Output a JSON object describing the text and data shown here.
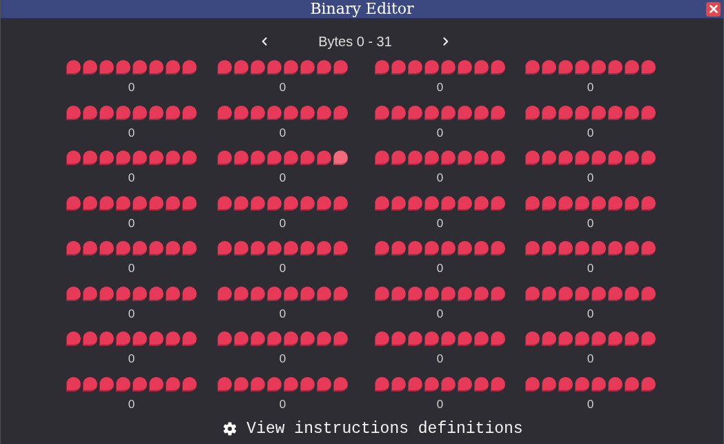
{
  "window": {
    "title": "Binary Editor"
  },
  "pager": {
    "label": "Bytes 0 - 31"
  },
  "bytes": [
    {
      "bits": [
        {
          "on": false,
          "hovered": false
        },
        {
          "on": false,
          "hovered": false
        },
        {
          "on": false,
          "hovered": false
        },
        {
          "on": false,
          "hovered": false
        },
        {
          "on": false,
          "hovered": false
        },
        {
          "on": false,
          "hovered": false
        },
        {
          "on": false,
          "hovered": false
        },
        {
          "on": false,
          "hovered": false
        }
      ],
      "value": "0"
    },
    {
      "bits": [
        {
          "on": false,
          "hovered": false
        },
        {
          "on": false,
          "hovered": false
        },
        {
          "on": false,
          "hovered": false
        },
        {
          "on": false,
          "hovered": false
        },
        {
          "on": false,
          "hovered": false
        },
        {
          "on": false,
          "hovered": false
        },
        {
          "on": false,
          "hovered": false
        },
        {
          "on": false,
          "hovered": false
        }
      ],
      "value": "0"
    },
    {
      "bits": [
        {
          "on": false,
          "hovered": false
        },
        {
          "on": false,
          "hovered": false
        },
        {
          "on": false,
          "hovered": false
        },
        {
          "on": false,
          "hovered": false
        },
        {
          "on": false,
          "hovered": false
        },
        {
          "on": false,
          "hovered": false
        },
        {
          "on": false,
          "hovered": false
        },
        {
          "on": false,
          "hovered": false
        }
      ],
      "value": "0"
    },
    {
      "bits": [
        {
          "on": false,
          "hovered": false
        },
        {
          "on": false,
          "hovered": false
        },
        {
          "on": false,
          "hovered": false
        },
        {
          "on": false,
          "hovered": false
        },
        {
          "on": false,
          "hovered": false
        },
        {
          "on": false,
          "hovered": false
        },
        {
          "on": false,
          "hovered": false
        },
        {
          "on": false,
          "hovered": false
        }
      ],
      "value": "0"
    },
    {
      "bits": [
        {
          "on": false,
          "hovered": false
        },
        {
          "on": false,
          "hovered": false
        },
        {
          "on": false,
          "hovered": false
        },
        {
          "on": false,
          "hovered": false
        },
        {
          "on": false,
          "hovered": false
        },
        {
          "on": false,
          "hovered": false
        },
        {
          "on": false,
          "hovered": false
        },
        {
          "on": false,
          "hovered": false
        }
      ],
      "value": "0"
    },
    {
      "bits": [
        {
          "on": false,
          "hovered": false
        },
        {
          "on": false,
          "hovered": false
        },
        {
          "on": false,
          "hovered": false
        },
        {
          "on": false,
          "hovered": false
        },
        {
          "on": false,
          "hovered": false
        },
        {
          "on": false,
          "hovered": false
        },
        {
          "on": false,
          "hovered": false
        },
        {
          "on": false,
          "hovered": false
        }
      ],
      "value": "0"
    },
    {
      "bits": [
        {
          "on": false,
          "hovered": false
        },
        {
          "on": false,
          "hovered": false
        },
        {
          "on": false,
          "hovered": false
        },
        {
          "on": false,
          "hovered": false
        },
        {
          "on": false,
          "hovered": false
        },
        {
          "on": false,
          "hovered": false
        },
        {
          "on": false,
          "hovered": false
        },
        {
          "on": false,
          "hovered": false
        }
      ],
      "value": "0"
    },
    {
      "bits": [
        {
          "on": false,
          "hovered": false
        },
        {
          "on": false,
          "hovered": false
        },
        {
          "on": false,
          "hovered": false
        },
        {
          "on": false,
          "hovered": false
        },
        {
          "on": false,
          "hovered": false
        },
        {
          "on": false,
          "hovered": false
        },
        {
          "on": false,
          "hovered": false
        },
        {
          "on": false,
          "hovered": false
        }
      ],
      "value": "0"
    },
    {
      "bits": [
        {
          "on": false,
          "hovered": false
        },
        {
          "on": false,
          "hovered": false
        },
        {
          "on": false,
          "hovered": false
        },
        {
          "on": false,
          "hovered": false
        },
        {
          "on": false,
          "hovered": false
        },
        {
          "on": false,
          "hovered": false
        },
        {
          "on": false,
          "hovered": false
        },
        {
          "on": false,
          "hovered": false
        }
      ],
      "value": "0"
    },
    {
      "bits": [
        {
          "on": false,
          "hovered": false
        },
        {
          "on": false,
          "hovered": false
        },
        {
          "on": false,
          "hovered": false
        },
        {
          "on": false,
          "hovered": false
        },
        {
          "on": false,
          "hovered": false
        },
        {
          "on": false,
          "hovered": false
        },
        {
          "on": false,
          "hovered": false
        },
        {
          "on": false,
          "hovered": true
        }
      ],
      "value": "0"
    },
    {
      "bits": [
        {
          "on": false,
          "hovered": false
        },
        {
          "on": false,
          "hovered": false
        },
        {
          "on": false,
          "hovered": false
        },
        {
          "on": false,
          "hovered": false
        },
        {
          "on": false,
          "hovered": false
        },
        {
          "on": false,
          "hovered": false
        },
        {
          "on": false,
          "hovered": false
        },
        {
          "on": false,
          "hovered": false
        }
      ],
      "value": "0"
    },
    {
      "bits": [
        {
          "on": false,
          "hovered": false
        },
        {
          "on": false,
          "hovered": false
        },
        {
          "on": false,
          "hovered": false
        },
        {
          "on": false,
          "hovered": false
        },
        {
          "on": false,
          "hovered": false
        },
        {
          "on": false,
          "hovered": false
        },
        {
          "on": false,
          "hovered": false
        },
        {
          "on": false,
          "hovered": false
        }
      ],
      "value": "0"
    },
    {
      "bits": [
        {
          "on": false,
          "hovered": false
        },
        {
          "on": false,
          "hovered": false
        },
        {
          "on": false,
          "hovered": false
        },
        {
          "on": false,
          "hovered": false
        },
        {
          "on": false,
          "hovered": false
        },
        {
          "on": false,
          "hovered": false
        },
        {
          "on": false,
          "hovered": false
        },
        {
          "on": false,
          "hovered": false
        }
      ],
      "value": "0"
    },
    {
      "bits": [
        {
          "on": false,
          "hovered": false
        },
        {
          "on": false,
          "hovered": false
        },
        {
          "on": false,
          "hovered": false
        },
        {
          "on": false,
          "hovered": false
        },
        {
          "on": false,
          "hovered": false
        },
        {
          "on": false,
          "hovered": false
        },
        {
          "on": false,
          "hovered": false
        },
        {
          "on": false,
          "hovered": false
        }
      ],
      "value": "0"
    },
    {
      "bits": [
        {
          "on": false,
          "hovered": false
        },
        {
          "on": false,
          "hovered": false
        },
        {
          "on": false,
          "hovered": false
        },
        {
          "on": false,
          "hovered": false
        },
        {
          "on": false,
          "hovered": false
        },
        {
          "on": false,
          "hovered": false
        },
        {
          "on": false,
          "hovered": false
        },
        {
          "on": false,
          "hovered": false
        }
      ],
      "value": "0"
    },
    {
      "bits": [
        {
          "on": false,
          "hovered": false
        },
        {
          "on": false,
          "hovered": false
        },
        {
          "on": false,
          "hovered": false
        },
        {
          "on": false,
          "hovered": false
        },
        {
          "on": false,
          "hovered": false
        },
        {
          "on": false,
          "hovered": false
        },
        {
          "on": false,
          "hovered": false
        },
        {
          "on": false,
          "hovered": false
        }
      ],
      "value": "0"
    },
    {
      "bits": [
        {
          "on": false,
          "hovered": false
        },
        {
          "on": false,
          "hovered": false
        },
        {
          "on": false,
          "hovered": false
        },
        {
          "on": false,
          "hovered": false
        },
        {
          "on": false,
          "hovered": false
        },
        {
          "on": false,
          "hovered": false
        },
        {
          "on": false,
          "hovered": false
        },
        {
          "on": false,
          "hovered": false
        }
      ],
      "value": "0"
    },
    {
      "bits": [
        {
          "on": false,
          "hovered": false
        },
        {
          "on": false,
          "hovered": false
        },
        {
          "on": false,
          "hovered": false
        },
        {
          "on": false,
          "hovered": false
        },
        {
          "on": false,
          "hovered": false
        },
        {
          "on": false,
          "hovered": false
        },
        {
          "on": false,
          "hovered": false
        },
        {
          "on": false,
          "hovered": false
        }
      ],
      "value": "0"
    },
    {
      "bits": [
        {
          "on": false,
          "hovered": false
        },
        {
          "on": false,
          "hovered": false
        },
        {
          "on": false,
          "hovered": false
        },
        {
          "on": false,
          "hovered": false
        },
        {
          "on": false,
          "hovered": false
        },
        {
          "on": false,
          "hovered": false
        },
        {
          "on": false,
          "hovered": false
        },
        {
          "on": false,
          "hovered": false
        }
      ],
      "value": "0"
    },
    {
      "bits": [
        {
          "on": false,
          "hovered": false
        },
        {
          "on": false,
          "hovered": false
        },
        {
          "on": false,
          "hovered": false
        },
        {
          "on": false,
          "hovered": false
        },
        {
          "on": false,
          "hovered": false
        },
        {
          "on": false,
          "hovered": false
        },
        {
          "on": false,
          "hovered": false
        },
        {
          "on": false,
          "hovered": false
        }
      ],
      "value": "0"
    },
    {
      "bits": [
        {
          "on": false,
          "hovered": false
        },
        {
          "on": false,
          "hovered": false
        },
        {
          "on": false,
          "hovered": false
        },
        {
          "on": false,
          "hovered": false
        },
        {
          "on": false,
          "hovered": false
        },
        {
          "on": false,
          "hovered": false
        },
        {
          "on": false,
          "hovered": false
        },
        {
          "on": false,
          "hovered": false
        }
      ],
      "value": "0"
    },
    {
      "bits": [
        {
          "on": false,
          "hovered": false
        },
        {
          "on": false,
          "hovered": false
        },
        {
          "on": false,
          "hovered": false
        },
        {
          "on": false,
          "hovered": false
        },
        {
          "on": false,
          "hovered": false
        },
        {
          "on": false,
          "hovered": false
        },
        {
          "on": false,
          "hovered": false
        },
        {
          "on": false,
          "hovered": false
        }
      ],
      "value": "0"
    },
    {
      "bits": [
        {
          "on": false,
          "hovered": false
        },
        {
          "on": false,
          "hovered": false
        },
        {
          "on": false,
          "hovered": false
        },
        {
          "on": false,
          "hovered": false
        },
        {
          "on": false,
          "hovered": false
        },
        {
          "on": false,
          "hovered": false
        },
        {
          "on": false,
          "hovered": false
        },
        {
          "on": false,
          "hovered": false
        }
      ],
      "value": "0"
    },
    {
      "bits": [
        {
          "on": false,
          "hovered": false
        },
        {
          "on": false,
          "hovered": false
        },
        {
          "on": false,
          "hovered": false
        },
        {
          "on": false,
          "hovered": false
        },
        {
          "on": false,
          "hovered": false
        },
        {
          "on": false,
          "hovered": false
        },
        {
          "on": false,
          "hovered": false
        },
        {
          "on": false,
          "hovered": false
        }
      ],
      "value": "0"
    },
    {
      "bits": [
        {
          "on": false,
          "hovered": false
        },
        {
          "on": false,
          "hovered": false
        },
        {
          "on": false,
          "hovered": false
        },
        {
          "on": false,
          "hovered": false
        },
        {
          "on": false,
          "hovered": false
        },
        {
          "on": false,
          "hovered": false
        },
        {
          "on": false,
          "hovered": false
        },
        {
          "on": false,
          "hovered": false
        }
      ],
      "value": "0"
    },
    {
      "bits": [
        {
          "on": false,
          "hovered": false
        },
        {
          "on": false,
          "hovered": false
        },
        {
          "on": false,
          "hovered": false
        },
        {
          "on": false,
          "hovered": false
        },
        {
          "on": false,
          "hovered": false
        },
        {
          "on": false,
          "hovered": false
        },
        {
          "on": false,
          "hovered": false
        },
        {
          "on": false,
          "hovered": false
        }
      ],
      "value": "0"
    },
    {
      "bits": [
        {
          "on": false,
          "hovered": false
        },
        {
          "on": false,
          "hovered": false
        },
        {
          "on": false,
          "hovered": false
        },
        {
          "on": false,
          "hovered": false
        },
        {
          "on": false,
          "hovered": false
        },
        {
          "on": false,
          "hovered": false
        },
        {
          "on": false,
          "hovered": false
        },
        {
          "on": false,
          "hovered": false
        }
      ],
      "value": "0"
    },
    {
      "bits": [
        {
          "on": false,
          "hovered": false
        },
        {
          "on": false,
          "hovered": false
        },
        {
          "on": false,
          "hovered": false
        },
        {
          "on": false,
          "hovered": false
        },
        {
          "on": false,
          "hovered": false
        },
        {
          "on": false,
          "hovered": false
        },
        {
          "on": false,
          "hovered": false
        },
        {
          "on": false,
          "hovered": false
        }
      ],
      "value": "0"
    },
    {
      "bits": [
        {
          "on": false,
          "hovered": false
        },
        {
          "on": false,
          "hovered": false
        },
        {
          "on": false,
          "hovered": false
        },
        {
          "on": false,
          "hovered": false
        },
        {
          "on": false,
          "hovered": false
        },
        {
          "on": false,
          "hovered": false
        },
        {
          "on": false,
          "hovered": false
        },
        {
          "on": false,
          "hovered": false
        }
      ],
      "value": "0"
    },
    {
      "bits": [
        {
          "on": false,
          "hovered": false
        },
        {
          "on": false,
          "hovered": false
        },
        {
          "on": false,
          "hovered": false
        },
        {
          "on": false,
          "hovered": false
        },
        {
          "on": false,
          "hovered": false
        },
        {
          "on": false,
          "hovered": false
        },
        {
          "on": false,
          "hovered": false
        },
        {
          "on": false,
          "hovered": false
        }
      ],
      "value": "0"
    },
    {
      "bits": [
        {
          "on": false,
          "hovered": false
        },
        {
          "on": false,
          "hovered": false
        },
        {
          "on": false,
          "hovered": false
        },
        {
          "on": false,
          "hovered": false
        },
        {
          "on": false,
          "hovered": false
        },
        {
          "on": false,
          "hovered": false
        },
        {
          "on": false,
          "hovered": false
        },
        {
          "on": false,
          "hovered": false
        }
      ],
      "value": "0"
    },
    {
      "bits": [
        {
          "on": false,
          "hovered": false
        },
        {
          "on": false,
          "hovered": false
        },
        {
          "on": false,
          "hovered": false
        },
        {
          "on": false,
          "hovered": false
        },
        {
          "on": false,
          "hovered": false
        },
        {
          "on": false,
          "hovered": false
        },
        {
          "on": false,
          "hovered": false
        },
        {
          "on": false,
          "hovered": false
        }
      ],
      "value": "0"
    }
  ],
  "footer": {
    "link": "View instructions definitions"
  }
}
